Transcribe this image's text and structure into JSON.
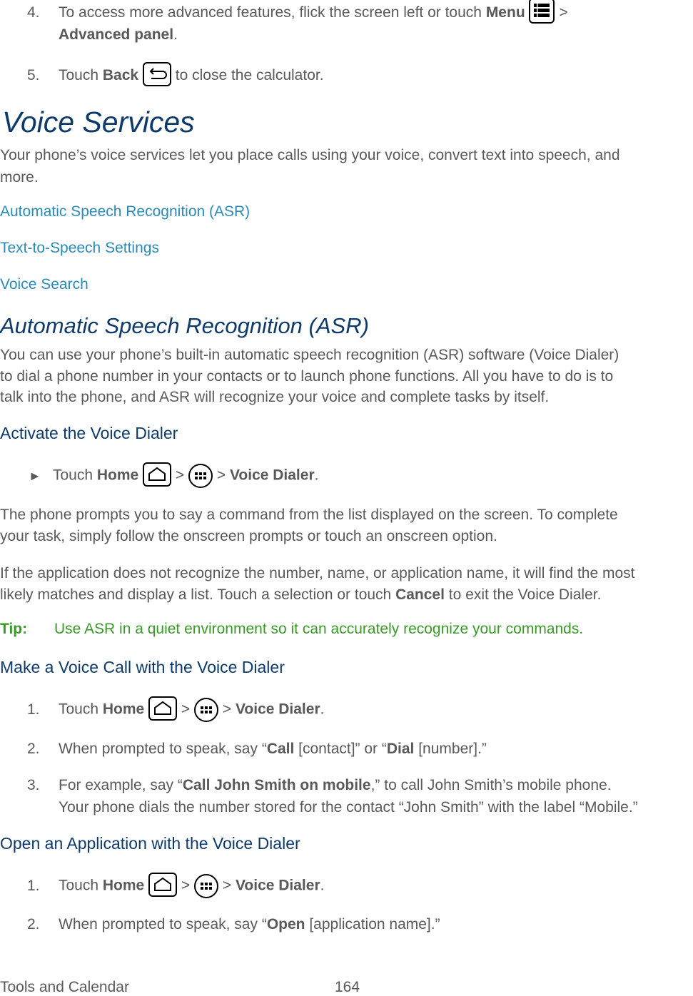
{
  "step4": {
    "number": "4.",
    "text_before": "To access more advanced features, flick the screen left or touch ",
    "menu_label": "Menu",
    "sep": " >",
    "advanced_label": "Advanced panel",
    "end": "."
  },
  "step5": {
    "number": "5.",
    "text_before": "Touch ",
    "back_label": "Back",
    "text_after": " to close the calculator."
  },
  "voice_services": {
    "title": "Voice Services",
    "intro_line1": "Your phone’s voice services let you place calls using your voice, convert text into speech, and",
    "intro_line2": "more.",
    "links": [
      "Automatic Speech Recognition (ASR)",
      "Text-to-Speech Settings",
      "Voice Search"
    ]
  },
  "asr": {
    "title": "Automatic Speech Recognition (ASR)",
    "para_lines": [
      "You can use your phone’s built-in automatic speech recognition (ASR) software (Voice Dialer)",
      "to dial a phone number in your contacts or to launch phone functions. All you have to do is to",
      "talk into the phone, and ASR will recognize your voice and complete tasks by itself."
    ]
  },
  "activate": {
    "heading": "Activate the Voice Dialer",
    "bullet": "►",
    "touch": "Touch ",
    "home_label": "Home",
    "gt": " > ",
    "voice_dialer_label": "Voice Dialer",
    "end": ".",
    "para1_lines": [
      "The phone prompts you to say a command from the list displayed on the screen. To complete",
      "your task, simply follow the onscreen prompts or touch an onscreen option."
    ],
    "para2_line1": "If the application does not recognize the number, name, or application name, it will find the most",
    "para2_line2_before": "likely matches and display a list. Touch a selection or touch ",
    "cancel_label": "Cancel",
    "para2_line2_after": " to exit the Voice Dialer.",
    "tip_label": "Tip:",
    "tip_text": "Use ASR in a quiet environment so it can accurately recognize your commands."
  },
  "voice_call": {
    "heading": "Make a Voice Call with the Voice Dialer",
    "step1": {
      "number": "1.",
      "touch": "Touch ",
      "home_label": "Home",
      "gt": " > ",
      "voice_dialer_label": "Voice Dialer",
      "end": "."
    },
    "step2": {
      "number": "2.",
      "before": "When prompted to speak, say “",
      "call_label": "Call",
      "mid": " [contact]” or “",
      "dial_label": "Dial",
      "after": " [number].”"
    },
    "step3": {
      "number": "3.",
      "before": "For example, say “",
      "example_label": "Call John Smith on mobile",
      "after": ",” to call John Smith’s mobile phone.",
      "line2": "Your phone dials the number stored for the contact “John Smith” with the label “Mobile.”"
    }
  },
  "open_app": {
    "heading": "Open an Application with the Voice Dialer",
    "step1": {
      "number": "1.",
      "touch": "Touch ",
      "home_label": "Home",
      "gt": " > ",
      "voice_dialer_label": "Voice Dialer",
      "end": "."
    },
    "step2": {
      "number": "2.",
      "before": "When prompted to speak, say “",
      "open_label": "Open",
      "after": " [application name].”"
    }
  },
  "footer": {
    "section": "Tools and Calendar",
    "page_number": "164"
  },
  "colors": {
    "heading": "#0d3a6b",
    "link": "#2a8ab8",
    "tip": "#3a9a28",
    "body": "#595959"
  }
}
